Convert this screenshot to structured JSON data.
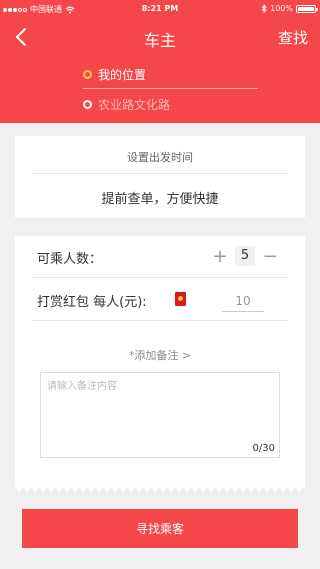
{
  "status_bar": {
    "carrier": "中国联通",
    "time": "8:21 PM",
    "battery_text": "100%",
    "battery_level": 1.0
  },
  "nav": {
    "title": "车主",
    "action": "查找",
    "back_icon": "chevron-left-icon"
  },
  "locations": {
    "from": "我的位置",
    "to": "农业路文化路"
  },
  "departure": {
    "title": "设置出发时间",
    "subtitle": "提前查单，方便快捷"
  },
  "form": {
    "seats_label": "可乘人数：",
    "seats_value": "5",
    "plus": "+",
    "minus": "−",
    "reward_label": "打赏红包  每人(元):",
    "reward_value": "10",
    "note_link": "*添加备注 >",
    "note_placeholder": "请输入备注内容",
    "note_count": "0/30"
  },
  "submit_label": "寻找乘客",
  "colors": {
    "accent": "#f5474a",
    "start_ring": "#f7d24a",
    "red_packet": "#d71a1a"
  }
}
